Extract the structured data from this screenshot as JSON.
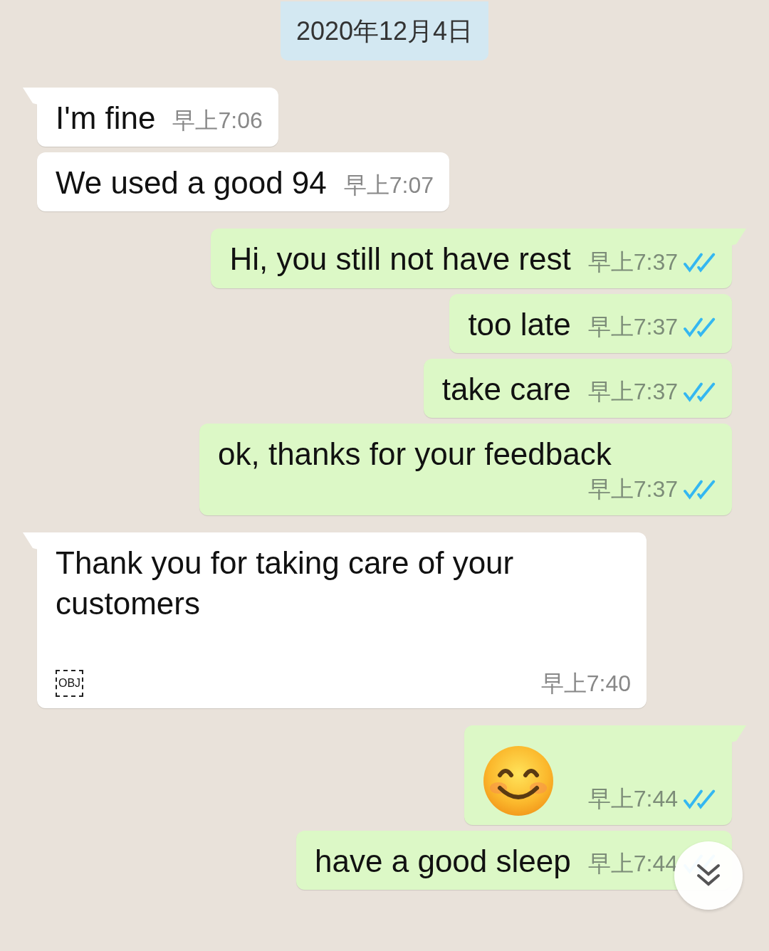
{
  "date_chip": "2020年12月4日",
  "messages": [
    {
      "kind": "text",
      "outgoing": false,
      "tail": true,
      "text": "I'm fine",
      "time": "早上7:06"
    },
    {
      "kind": "text",
      "outgoing": false,
      "tail": false,
      "text": "We used a good 94",
      "time": "早上7:07"
    },
    {
      "kind": "text",
      "outgoing": true,
      "tail": true,
      "text": "Hi, you still not have rest",
      "time": "早上7:37",
      "read": true
    },
    {
      "kind": "text",
      "outgoing": true,
      "tail": false,
      "text": "too late",
      "time": "早上7:37",
      "read": true
    },
    {
      "kind": "text",
      "outgoing": true,
      "tail": false,
      "text": "take care",
      "time": "早上7:37",
      "read": true
    },
    {
      "kind": "text",
      "outgoing": true,
      "tail": false,
      "text": "ok, thanks for your feedback",
      "time": "早上7:37",
      "read": true
    },
    {
      "kind": "attachment",
      "outgoing": false,
      "tail": true,
      "text": "Thank you for taking care of your customers",
      "attachment": "OBJ",
      "time": "早上7:40"
    },
    {
      "kind": "emoji",
      "outgoing": true,
      "tail": true,
      "time": "早上7:44",
      "read": true
    },
    {
      "kind": "text",
      "outgoing": true,
      "tail": false,
      "text": "have a good sleep",
      "time": "早上7:44",
      "read": true
    }
  ]
}
